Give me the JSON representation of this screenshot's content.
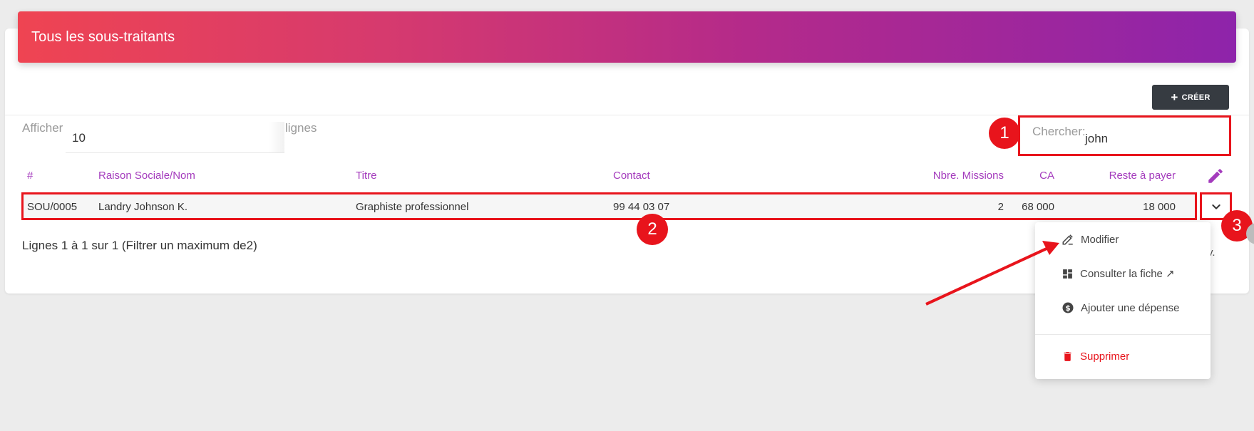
{
  "header": {
    "title": "Tous les sous-traitants"
  },
  "toolbar": {
    "create_label": "CRÉER"
  },
  "length": {
    "prefix": "Afficher",
    "value": "10",
    "suffix": "lignes"
  },
  "search": {
    "label": "Chercher:",
    "value": "john"
  },
  "table": {
    "columns": [
      "#",
      "Raison Sociale/Nom",
      "Titre",
      "Contact",
      "Nbre. Missions",
      "CA",
      "Reste à payer"
    ],
    "rows": [
      {
        "id": "SOU/0005",
        "name": "Landry Johnson K.",
        "title": "Graphiste professionnel",
        "contact": "99 44 03 07",
        "missions": "2",
        "ca": "68 000",
        "reste": "18 000"
      }
    ]
  },
  "info": "Lignes 1 à 1 sur 1 (Filtrer un maximum de2)",
  "pagination_fragment": "v.",
  "menu": {
    "items": [
      {
        "label": "Modifier",
        "icon": "pencil-icon"
      },
      {
        "label": "Consulter la fiche ↗",
        "icon": "dashboard-icon"
      },
      {
        "label": "Ajouter une dépense",
        "icon": "dollar-circle-icon"
      }
    ],
    "danger": {
      "label": "Supprimer",
      "icon": "trash-icon"
    }
  },
  "annotations": {
    "badge1": "1",
    "badge2": "2",
    "badge3": "3"
  },
  "colors": {
    "accent_purple": "#a43bbd",
    "annotation_red": "#e8141c",
    "dark_button": "#363b41"
  }
}
